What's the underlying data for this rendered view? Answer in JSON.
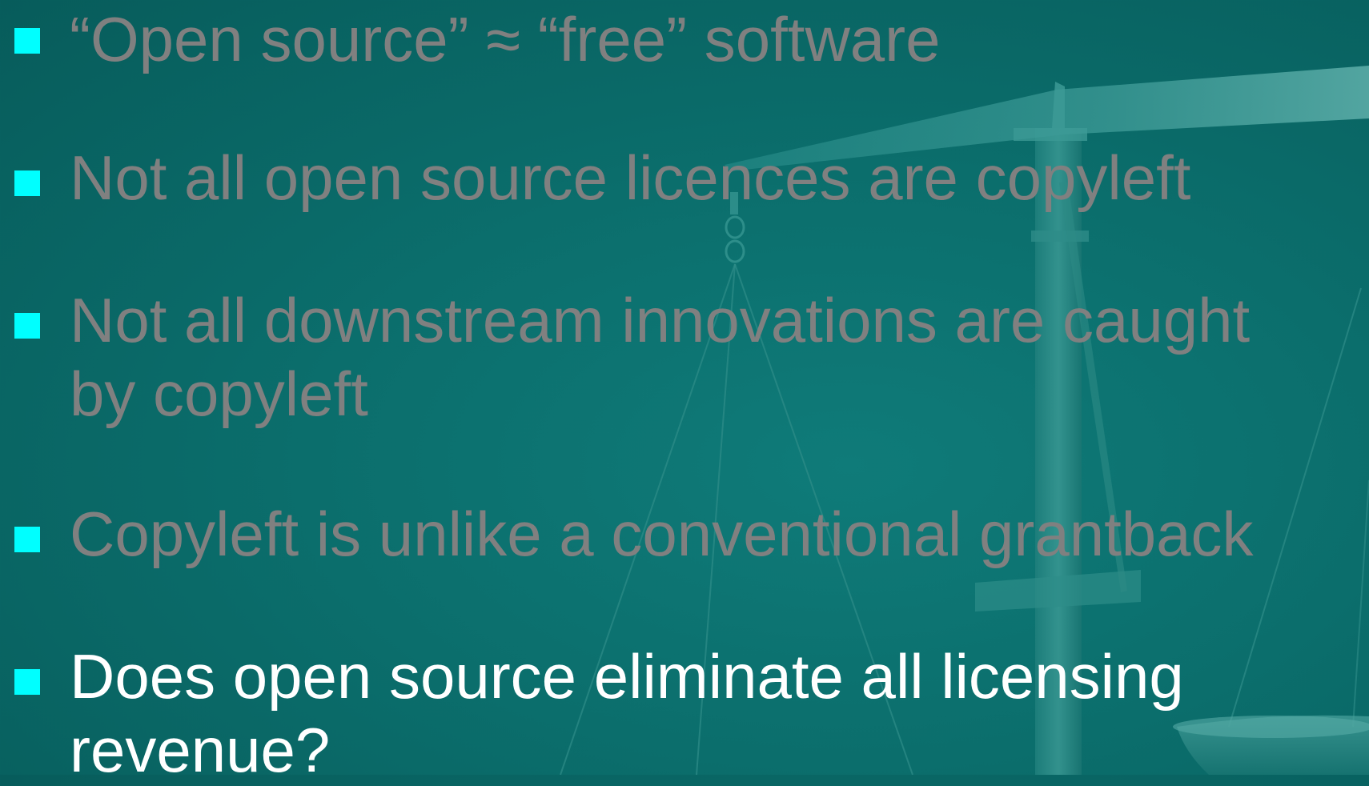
{
  "slide": {
    "bullets": [
      {
        "text": "“Open source” ≈ “free” software",
        "state": "dimmed"
      },
      {
        "text": "Not all open source licences are copyleft",
        "state": "dimmed"
      },
      {
        "line1": "Not all downstream innovations are caught",
        "line2": "by copyleft",
        "state": "dimmed"
      },
      {
        "text": "Copyleft is unlike a conventional grantback",
        "state": "dimmed"
      },
      {
        "line1": "Does open source eliminate all licensing",
        "line2": "revenue?",
        "state": "current"
      }
    ],
    "colors": {
      "background": "#0b6e6c",
      "bullet_marker": "#00ffff",
      "dimmed_text": "#808080",
      "current_text": "#ffffff"
    },
    "background_image": "scales-of-justice"
  }
}
